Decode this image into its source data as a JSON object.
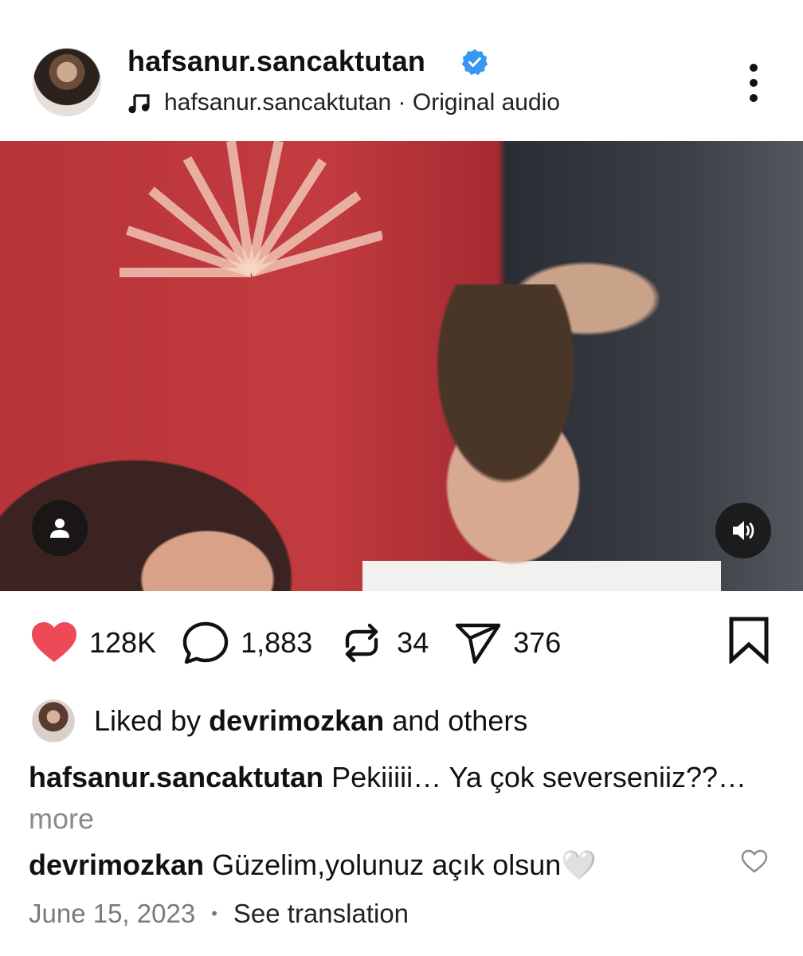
{
  "post": {
    "username": "hafsanur.sancaktutan",
    "audio": "hafsanur.sancaktutan · Original audio",
    "icons": {
      "verified": "verified-badge-icon",
      "audio": "music-note-icon",
      "more": "more-vertical-icon"
    }
  },
  "actions": {
    "likes": "128K",
    "comments": "1,883",
    "reposts": "34",
    "shares": "376",
    "like_color": "#ed4956"
  },
  "liked_by": {
    "prefix": "Liked by",
    "user": "devrimozkan",
    "suffix": "and others"
  },
  "caption": {
    "user": "hafsanur.sancaktutan",
    "text": "Pekiiiii… Ya çok severseniiz??…",
    "more": "more"
  },
  "top_comment": {
    "user": "devrimozkan",
    "text": "Güzelim,yolunuz açık olsun🤍"
  },
  "meta": {
    "date": "June 15, 2023",
    "separator": "•",
    "see_translation": "See translation"
  },
  "colors": {
    "verified": "#3897f0",
    "muted_text": "#7a7a7a"
  }
}
